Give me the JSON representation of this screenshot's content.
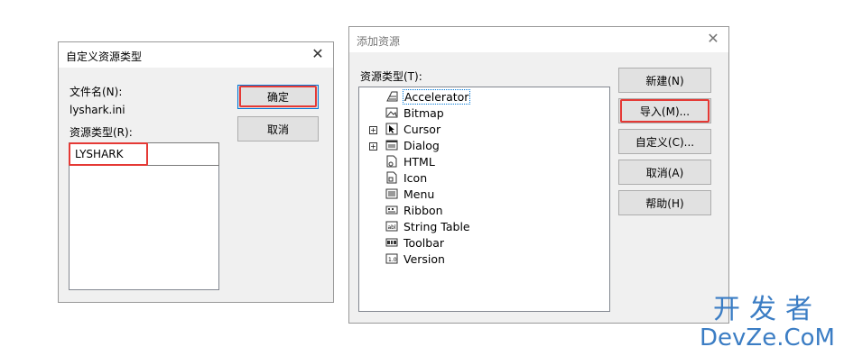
{
  "dialog1": {
    "title": "自定义资源类型",
    "close": "✕",
    "filename_label": "文件名(N):",
    "filename_value": "lyshark.ini",
    "resource_type_label": "资源类型(R):",
    "resource_type_value": "LYSHARK",
    "ok_label": "确定",
    "cancel_label": "取消"
  },
  "dialog2": {
    "title": "添加资源",
    "close": "✕",
    "resource_type_label": "资源类型(T):",
    "items": [
      {
        "label": "Accelerator",
        "icon": "accelerator-icon"
      },
      {
        "label": "Bitmap",
        "icon": "bitmap-icon"
      },
      {
        "label": "Cursor",
        "icon": "cursor-icon"
      },
      {
        "label": "Dialog",
        "icon": "dialog-icon"
      },
      {
        "label": "HTML",
        "icon": "html-icon"
      },
      {
        "label": "Icon",
        "icon": "icon-resource-icon"
      },
      {
        "label": "Menu",
        "icon": "menu-icon"
      },
      {
        "label": "Ribbon",
        "icon": "ribbon-icon"
      },
      {
        "label": "String Table",
        "icon": "string-table-icon"
      },
      {
        "label": "Toolbar",
        "icon": "toolbar-icon"
      },
      {
        "label": "Version",
        "icon": "version-icon"
      }
    ],
    "buttons": {
      "new": "新建(N)",
      "import": "导入(M)...",
      "custom": "自定义(C)...",
      "cancel": "取消(A)",
      "help": "帮助(H)"
    }
  },
  "watermark": {
    "cn": "开发者",
    "en": "DevZe.CoM"
  },
  "colors": {
    "highlight": "#e53935",
    "accent": "#0078d7",
    "watermark": "#3b7dc4"
  }
}
